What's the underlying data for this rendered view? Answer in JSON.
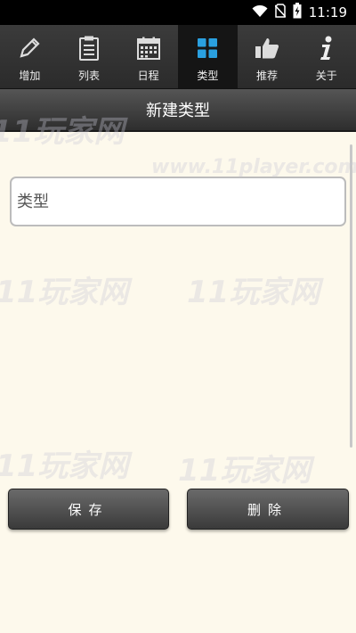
{
  "status_bar": {
    "time": "11:19",
    "icons": [
      "wifi-icon",
      "no-sim-icon",
      "battery-charging-icon"
    ]
  },
  "tabs": [
    {
      "label": "增加",
      "icon": "pencil-icon",
      "active": false
    },
    {
      "label": "列表",
      "icon": "clipboard-list-icon",
      "active": false
    },
    {
      "label": "日程",
      "icon": "calendar-icon",
      "active": false
    },
    {
      "label": "类型",
      "icon": "grid-icon",
      "active": true
    },
    {
      "label": "推荐",
      "icon": "thumbs-up-icon",
      "active": false
    },
    {
      "label": "关于",
      "icon": "info-icon",
      "active": false
    }
  ],
  "title": "新建类型",
  "form": {
    "type_placeholder": "类型",
    "type_value": ""
  },
  "buttons": {
    "save_label": "保存",
    "delete_label": "删除"
  },
  "watermark": {
    "brand": "11玩家网",
    "url": "www.11player.com"
  },
  "colors": {
    "background": "#fdf9ec",
    "tab_bar": "#333333",
    "tab_active": "#151515",
    "accent_blue": "#2aa0e0",
    "button": "#505050"
  }
}
